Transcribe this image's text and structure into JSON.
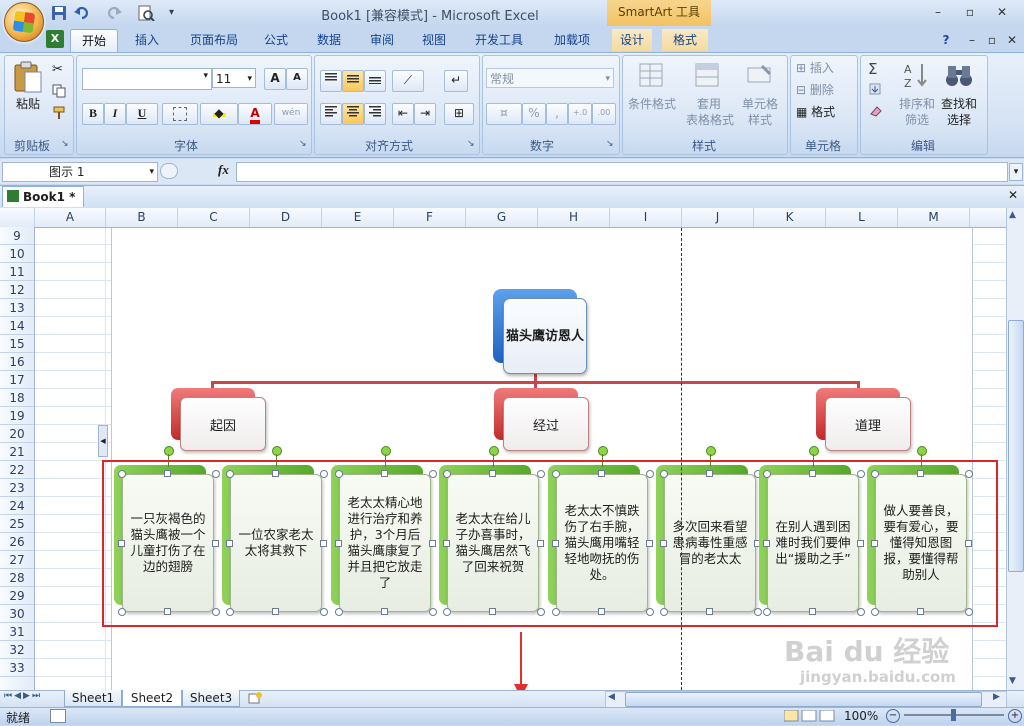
{
  "window": {
    "title": "Book1  [兼容模式] - Microsoft Excel",
    "context_tab_title": "SmartArt 工具",
    "min": "–",
    "restore": "▫",
    "close": "✕",
    "ribbon_help": "?",
    "ribbon_min": "–",
    "ribbon_restore": "▫",
    "ribbon_close": "✕"
  },
  "tabs": [
    "开始",
    "插入",
    "页面布局",
    "公式",
    "数据",
    "审阅",
    "视图",
    "开发工具",
    "加载项",
    "设计",
    "格式"
  ],
  "ribbon": {
    "clipboard": {
      "paste": "粘贴",
      "label": "剪贴板"
    },
    "font": {
      "size": "11",
      "grow": "A",
      "shrink": "A",
      "bold": "B",
      "italic": "I",
      "underline": "U",
      "label": "字体",
      "font_color": "A",
      "phonetic": "wén"
    },
    "alignment": {
      "label": "对齐方式"
    },
    "number": {
      "format": "常规",
      "percent": "%",
      "comma": ",",
      "inc_dec": "+.0",
      "dec_dec": ".00",
      "label": "数字"
    },
    "styles": {
      "cond_format": "条件格式",
      "table_format_1": "套用",
      "table_format_2": "表格格式",
      "cell_style_1": "单元格",
      "cell_style_2": "样式",
      "label": "样式"
    },
    "cells": {
      "insert": "插入",
      "delete": "删除",
      "format": "格式",
      "label": "单元格"
    },
    "editing": {
      "sum": "Σ",
      "sort_1": "排序和",
      "sort_2": "筛选",
      "find_1": "查找和",
      "find_2": "选择",
      "label": "编辑"
    }
  },
  "formula_bar": {
    "name_box": "图示 1",
    "fx": "fx",
    "value": ""
  },
  "workbook_tab": "Book1 *",
  "columns": [
    "A",
    "B",
    "C",
    "D",
    "E",
    "F",
    "G",
    "H",
    "I",
    "J",
    "K",
    "L",
    "M"
  ],
  "rows": [
    "9",
    "10",
    "11",
    "12",
    "13",
    "14",
    "15",
    "16",
    "17",
    "18",
    "19",
    "20",
    "21",
    "22",
    "23",
    "24",
    "25",
    "26",
    "27",
    "28",
    "29",
    "30",
    "31",
    "32",
    "33"
  ],
  "smartart": {
    "root": "猫头鹰访恩人",
    "groups": [
      "起因",
      "经过",
      "道理"
    ],
    "leaves": [
      "一只灰褐色的猫头鹰被一个儿童打伤了在边的翅膀",
      "一位农家老太太将其救下",
      "老太太精心地进行治疗和养护，3个月后猫头鹰康复了并且把它放走了",
      "老太太在给儿子办喜事时，猫头鹰居然飞了回来祝贺",
      "老太太不慎跌伤了右手腕，猫头鹰用嘴轻轻地吻抚的伤处。",
      "多次回来看望患病毒性重感冒的老太太",
      "在别人遇到困难时我们要伸出“援助之手”",
      "做人要善良，要有爱心，要懂得知恩图报，要懂得帮助别人"
    ],
    "colors": {
      "root": "#1f63c0",
      "group": "#c32b2b",
      "leaf": "#56a82a",
      "connector": "#c8474a",
      "highlight": "#d9262b"
    }
  },
  "sheets": [
    "Sheet1",
    "Sheet2",
    "Sheet3"
  ],
  "status": {
    "ready": "就绪",
    "zoom": "100%"
  },
  "watermark": {
    "line1": "Bai du 经验",
    "line2": "jingyan.baidu.com"
  }
}
